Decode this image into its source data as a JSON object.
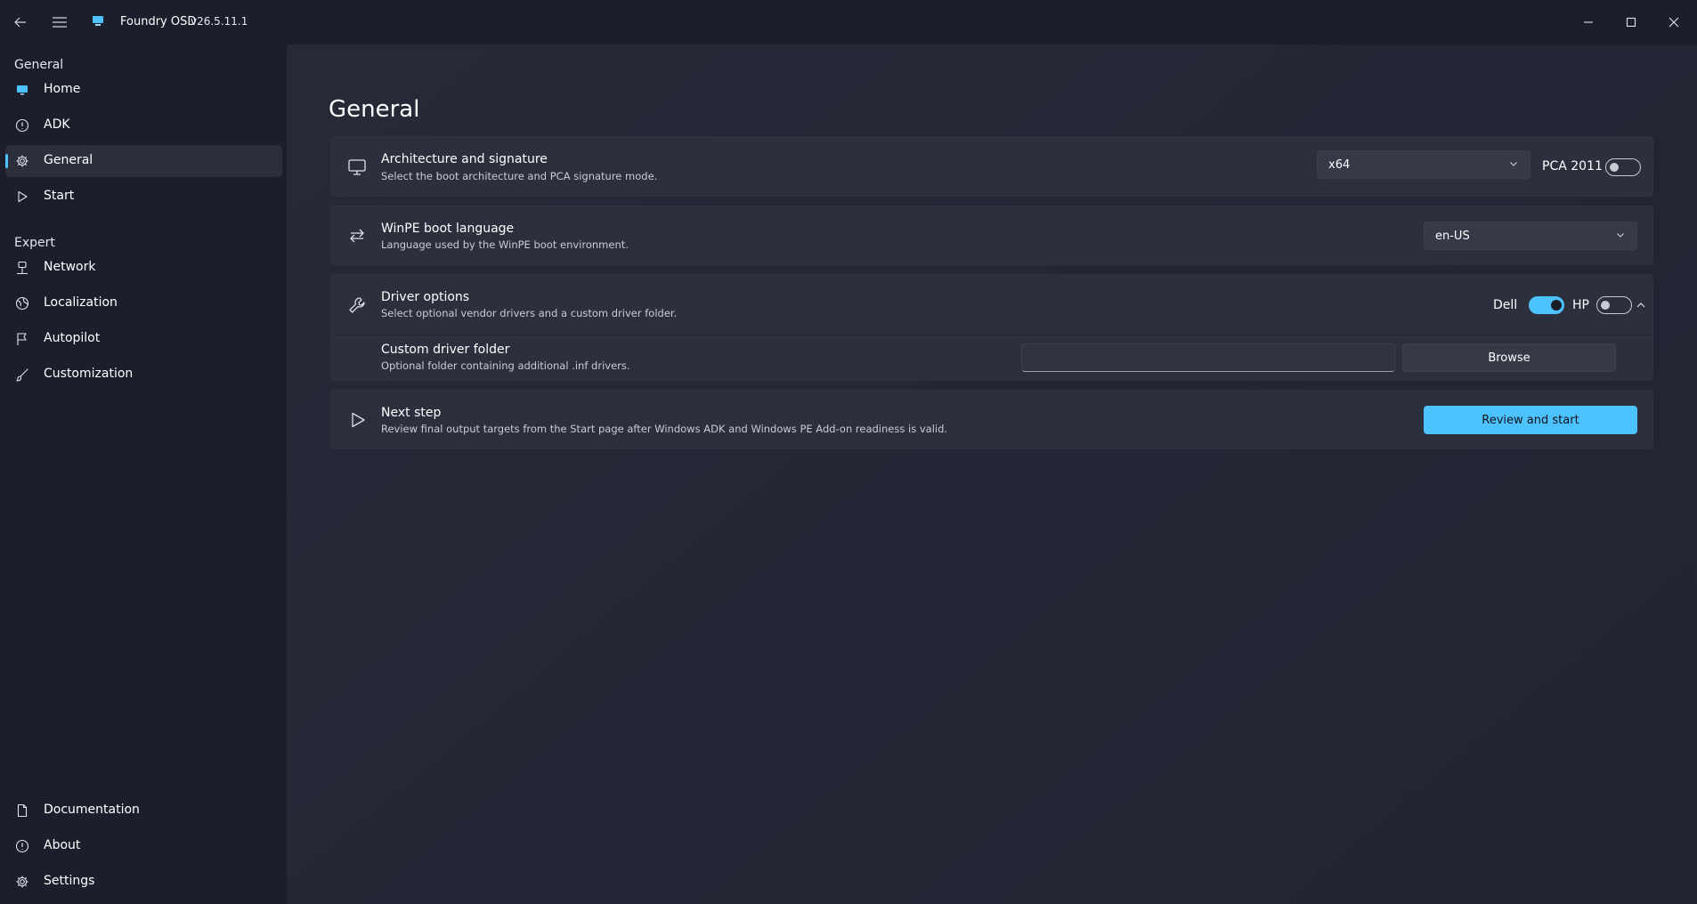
{
  "app": {
    "title": "Foundry OSD",
    "version": "v26.5.11.1"
  },
  "sidebar": {
    "general_section": "General",
    "expert_section": "Expert",
    "items": [
      {
        "label": "Home",
        "icon": "monitor-icon"
      },
      {
        "label": "ADK",
        "icon": "info-icon"
      },
      {
        "label": "General",
        "icon": "gear-icon",
        "selected": true
      },
      {
        "label": "Start",
        "icon": "play-icon"
      },
      {
        "label": "Network",
        "icon": "network-icon"
      },
      {
        "label": "Localization",
        "icon": "globe-icon"
      },
      {
        "label": "Autopilot",
        "icon": "flag-icon"
      },
      {
        "label": "Customization",
        "icon": "brush-icon"
      }
    ],
    "footer_items": [
      {
        "label": "Documentation",
        "icon": "document-icon"
      },
      {
        "label": "About",
        "icon": "info-icon"
      },
      {
        "label": "Settings",
        "icon": "gear-icon"
      }
    ]
  },
  "page": {
    "title": "General"
  },
  "architecture": {
    "title": "Architecture and signature",
    "subtitle": "Select the boot architecture and PCA signature mode.",
    "selected": "x64",
    "pca_label": "PCA 2011",
    "pca_enabled": false
  },
  "language": {
    "title": "WinPE boot language",
    "subtitle": "Language used by the WinPE boot environment.",
    "selected": "en-US"
  },
  "drivers": {
    "title": "Driver options",
    "subtitle": "Select optional vendor drivers and a custom driver folder.",
    "dell_label": "Dell",
    "dell_enabled": true,
    "hp_label": "HP",
    "hp_enabled": false,
    "folder_title": "Custom driver folder",
    "folder_subtitle": "Optional folder containing additional .inf drivers.",
    "folder_value": "",
    "browse_label": "Browse"
  },
  "next_step": {
    "title": "Next step",
    "subtitle": "Review final output targets from the Start page after Windows ADK and Windows PE Add-on readiness is valid.",
    "button_label": "Review and start"
  },
  "colors": {
    "accent": "#4cc2ff",
    "background": "#202330",
    "card": "#2c2f3c"
  }
}
